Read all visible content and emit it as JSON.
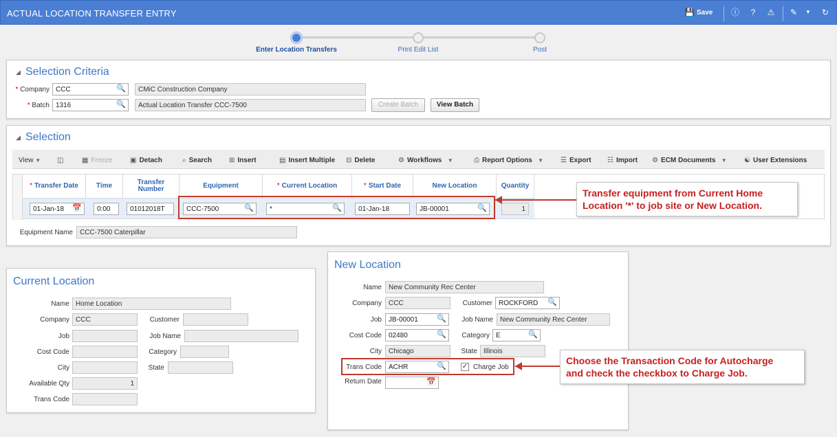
{
  "header": {
    "title": "ACTUAL LOCATION TRANSFER ENTRY",
    "save_label": "Save"
  },
  "train": {
    "steps": [
      "Enter Location Transfers",
      "Print Edit List",
      "Post"
    ]
  },
  "selection_criteria": {
    "title": "Selection Criteria",
    "company_label": "Company",
    "company_value": "CCC",
    "company_name": "CMiC Construction Company",
    "batch_label": "Batch",
    "batch_value": "1316",
    "batch_name": "Actual Location Transfer CCC-7500",
    "create_batch": "Create Batch",
    "view_batch": "View Batch"
  },
  "selection": {
    "title": "Selection",
    "toolbar": {
      "view": "View",
      "freeze": "Freeze",
      "detach": "Detach",
      "search": "Search",
      "insert": "Insert",
      "insert_multiple": "Insert Multiple",
      "delete": "Delete",
      "workflows": "Workflows",
      "report_options": "Report Options",
      "export": "Export",
      "import": "Import",
      "ecm_documents": "ECM Documents",
      "user_extensions": "User Extensions"
    },
    "columns": {
      "transfer_date": "Transfer Date",
      "time": "Time",
      "transfer_number": "Transfer Number",
      "equipment": "Equipment",
      "current_location": "Current Location",
      "start_date": "Start Date",
      "new_location": "New Location",
      "quantity": "Quantity"
    },
    "row": {
      "transfer_date": "01-Jan-18",
      "time": "0:00",
      "transfer_number": "01012018T",
      "equipment": "CCC-7500",
      "current_location": "*",
      "start_date": "01-Jan-18",
      "new_location": "JB-00001",
      "quantity": "1"
    },
    "equipment_name_label": "Equipment Name",
    "equipment_name_value": "CCC-7500 Caterpillar"
  },
  "current_location": {
    "title": "Current Location",
    "name_label": "Name",
    "name_value": "Home Location",
    "company_label": "Company",
    "company_value": "CCC",
    "customer_label": "Customer",
    "job_label": "Job",
    "job_name_label": "Job Name",
    "cost_code_label": "Cost Code",
    "category_label": "Category",
    "city_label": "City",
    "state_label": "State",
    "available_qty_label": "Available Qty",
    "available_qty_value": "1",
    "trans_code_label": "Trans Code"
  },
  "new_location": {
    "title": "New Location",
    "name_label": "Name",
    "name_value": "New Community Rec Center",
    "company_label": "Company",
    "company_value": "CCC",
    "customer_label": "Customer",
    "customer_value": "ROCKFORD",
    "job_label": "Job",
    "job_value": "JB-00001",
    "job_name_label": "Job Name",
    "job_name_value": "New Community Rec Center",
    "cost_code_label": "Cost Code",
    "cost_code_value": "02480",
    "category_label": "Category",
    "category_value": "E",
    "city_label": "City",
    "city_value": "Chicago",
    "state_label": "State",
    "state_value": "Illinois",
    "trans_code_label": "Trans Code",
    "trans_code_value": "ACHR",
    "charge_job_label": "Charge Job",
    "return_date_label": "Return Date"
  },
  "callouts": {
    "transfer_line1": "Transfer equipment from Current Home",
    "transfer_line2": "Location '*' to job site or New Location.",
    "trans_line1": "Choose the Transaction Code for Autocharge",
    "trans_line2": "and check the checkbox to Charge Job."
  },
  "colors": {
    "header": "#4a7fd4",
    "title_blue": "#3a78c8",
    "callout_red": "#c62020"
  }
}
